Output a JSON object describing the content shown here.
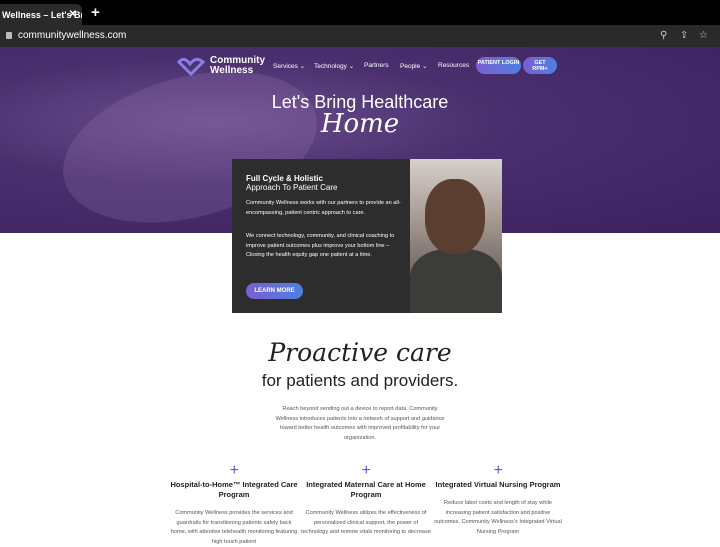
{
  "browser": {
    "tab_title": "Wellness – Let's Br",
    "url": "communitywellness.com",
    "icons": [
      "zoom-icon",
      "share-icon",
      "star-icon"
    ]
  },
  "header": {
    "logo_line1": "Community",
    "logo_line2": "Wellness",
    "nav": [
      {
        "label": "Services ⌄"
      },
      {
        "label": "Technology ⌄"
      },
      {
        "label": "Partners"
      },
      {
        "label": "People ⌄"
      },
      {
        "label": "Resources"
      }
    ],
    "patient_login": "PATIENT LOGIN",
    "get_rpm": "GET RPM+"
  },
  "hero": {
    "title": "Let's Bring Healthcare",
    "title_script": "Home"
  },
  "card": {
    "title_bold": "Full Cycle & Holistic",
    "title": "Approach To Patient Care",
    "p1": "Community Wellness works with our partners to provide an all-encompassing, patient centric approach to care.",
    "p2": "We connect technology, community, and clinical coaching to improve patient outcomes plus improve your bottom line – Closing the health equity gap one patient at a time.",
    "button": "LEARN MORE"
  },
  "section": {
    "script_title": "Proactive care",
    "subtitle": "for patients and providers.",
    "intro": "Reach beyond sending out a device to report data. Community Wellness introduces patients into a network of support and guidance toward better health outcomes with improved profitability for your organization.",
    "columns": [
      {
        "icon": "+",
        "title": "Hospital-to-Home™ Integrated Care Program",
        "body": "Community Wellness provides the services and guardrails for transitioning patients safely back home, with attentive telehealth monitoring featuring high touch patient"
      },
      {
        "icon": "+",
        "title": "Integrated Maternal Care at Home Program",
        "body": "Community Wellness utilizes the effectiveness of personalized clinical support, the power of technology and remote vitals monitoring to decrease"
      },
      {
        "icon": "+",
        "title": "Integrated Virtual Nursing Program",
        "body": "Reduce labor costs and length of stay while increasing patient satisfaction and positive outcomes. Community Wellness's Integrated Virtual Nursing Program"
      }
    ]
  },
  "colors": {
    "hero": "#4a2f6e",
    "accent_start": "#7b5fd0",
    "accent_end": "#4e7fe0",
    "card": "#2d2d2d"
  }
}
